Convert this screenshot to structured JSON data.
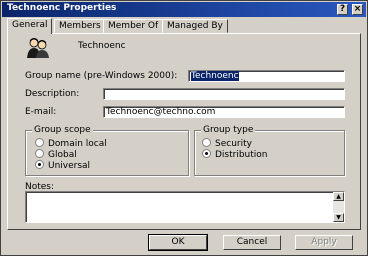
{
  "window": {
    "title": "Technoenc Properties",
    "help_glyph": "?",
    "close_glyph": "×"
  },
  "tabs": [
    {
      "label": "General",
      "active": true
    },
    {
      "label": "Members",
      "active": false
    },
    {
      "label": "Member Of",
      "active": false
    },
    {
      "label": "Managed By",
      "active": false
    }
  ],
  "general": {
    "group_name": "Technoenc",
    "labels": {
      "group_name_pre2000": "Group name (pre-Windows 2000):",
      "description": "Description:",
      "email": "E-mail:",
      "notes": "Notes:"
    },
    "fields": {
      "group_name_pre2000": "Technoenc",
      "description": "",
      "email": "Technoenc@techno.com"
    },
    "group_scope": {
      "legend": "Group scope",
      "options": [
        {
          "label": "Domain local",
          "selected": false
        },
        {
          "label": "Global",
          "selected": false
        },
        {
          "label": "Universal",
          "selected": true
        }
      ]
    },
    "group_type": {
      "legend": "Group type",
      "options": [
        {
          "label": "Security",
          "selected": false
        },
        {
          "label": "Distribution",
          "selected": true
        }
      ]
    }
  },
  "buttons": {
    "ok": "OK",
    "cancel": "Cancel",
    "apply": "Apply"
  },
  "colors": {
    "titlebar": "#0a246a",
    "face": "#d4d0c8",
    "selection": "#0a246a"
  }
}
